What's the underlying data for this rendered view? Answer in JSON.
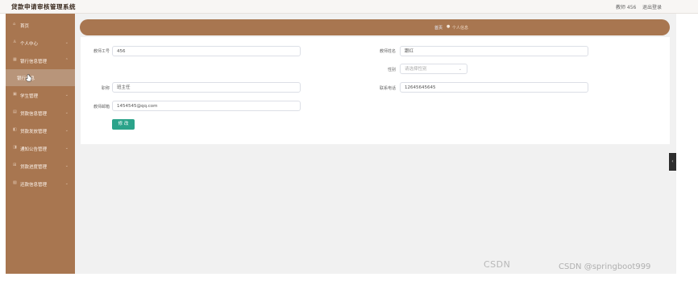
{
  "app": {
    "title": "贷款申请审核管理系统"
  },
  "header": {
    "user_label": "教师 456",
    "logout_label": "退出登录"
  },
  "sidebar": {
    "items": [
      {
        "icon": "home-icon",
        "label": "首页",
        "has_chevron": false
      },
      {
        "icon": "user-icon",
        "label": "个人中心",
        "has_chevron": true
      },
      {
        "icon": "bank-icon",
        "label": "银行信息管理",
        "has_chevron": true
      },
      {
        "icon": "",
        "label": "银行信息",
        "has_chevron": false,
        "sub": true
      },
      {
        "icon": "student-icon",
        "label": "学生管理",
        "has_chevron": true
      },
      {
        "icon": "loan-info-icon",
        "label": "贷款信息管理",
        "has_chevron": true
      },
      {
        "icon": "loan-release-icon",
        "label": "贷款发放管理",
        "has_chevron": true
      },
      {
        "icon": "notice-icon",
        "label": "通知公告管理",
        "has_chevron": true
      },
      {
        "icon": "loan-progress-icon",
        "label": "贷款进度管理",
        "has_chevron": true
      },
      {
        "icon": "repayment-icon",
        "label": "还款信息管理",
        "has_chevron": true
      }
    ]
  },
  "breadcrumb": {
    "home": "首页",
    "current": "个人信息"
  },
  "form": {
    "teacher_id_label": "教师工号",
    "teacher_id_value": "456",
    "teacher_name_label": "教师姓名",
    "teacher_name_value": "跟红",
    "gender_label": "性别",
    "gender_placeholder": "请选择性别",
    "title_label": "职称",
    "title_value": "班主任",
    "phone_label": "联系电话",
    "phone_value": "12645645645",
    "email_label": "教师邮箱",
    "email_value": "1454545@qq.com",
    "submit_label": "修 改"
  },
  "watermark": {
    "logo": "CSDN",
    "text": "CSDN @springboot999"
  },
  "colors": {
    "brand": "#a87650",
    "submit": "#2ba38a"
  }
}
